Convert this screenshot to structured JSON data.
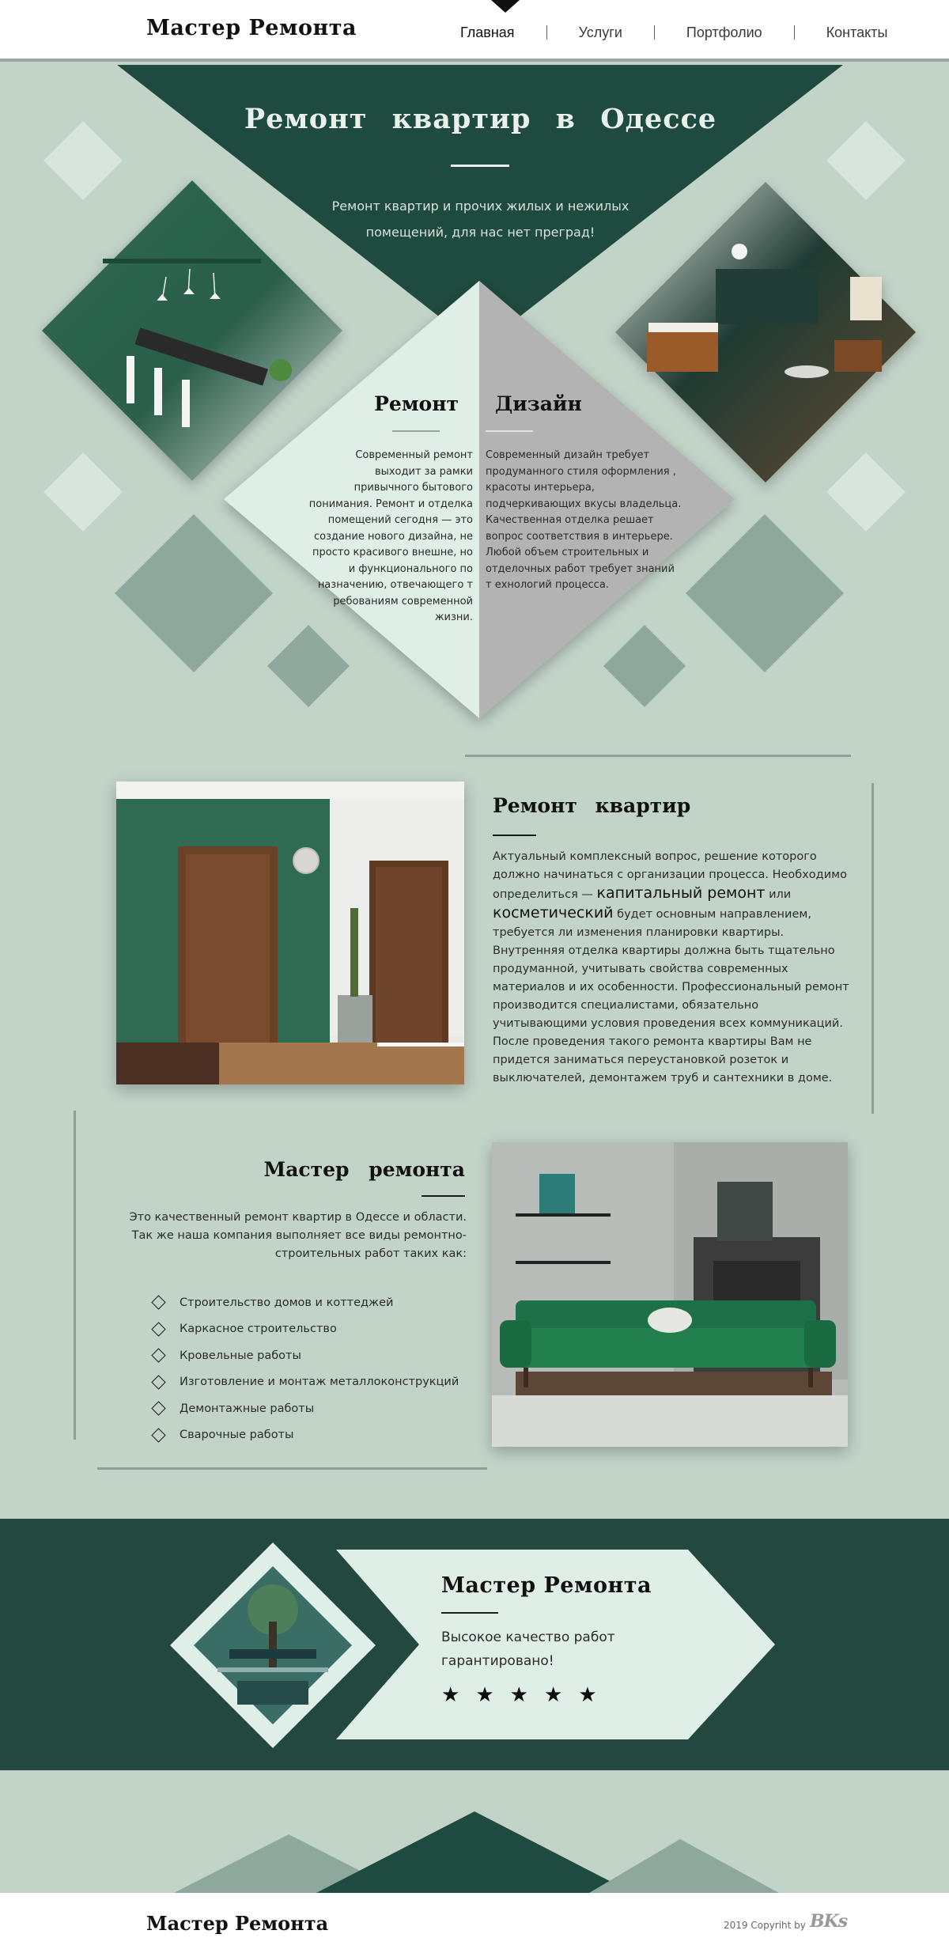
{
  "header": {
    "logo": "Мастер Ремонта",
    "nav": [
      {
        "label": "Главная",
        "active": true
      },
      {
        "label": "Услуги",
        "active": false
      },
      {
        "label": "Портфолио",
        "active": false
      },
      {
        "label": "Контакты",
        "active": false
      }
    ]
  },
  "hero": {
    "title": "Ремонт квартир в Одессе",
    "subtitle": "Ремонт квартир и прочих жилых и нежилых помещений, для нас нет преград!",
    "columns": {
      "repair": {
        "title": "Ремонт",
        "text": "Современный ремонт выходит за рамки привычного бытового понимания. Ремонт и отделка помещений сегодня — это создание нового дизайна, не просто красивого внешне, но и функционального по назначению, отвечающего т ребованиям современной жизни."
      },
      "design": {
        "title": "Дизайн",
        "text": "Современный дизайн требует продуманного стиля оформления , красоты интерьера, подчеркивающих вкусы владельца. Качественная отделка решает вопрос соответствия в интерьере. Любой объем строительных и отделочных работ требует знаний т ехнологий процесса."
      }
    }
  },
  "about": {
    "title": "Ремонт квартир",
    "text_before": "Актуальный комплексный вопрос, решение которого должно начинаться с организации процесса. Необходимо определиться — ",
    "emph1": "капитальный ремонт",
    "text_mid": " или ",
    "emph2": "косметический",
    "text_after": " будет основным направлением, требуется ли изменения планировки квартиры. Внутренняя отделка квартиры должна быть тщательно продуманной, учитывать свойства современных материалов и их особенности. Профессиональный ремонт производится специалистами, обязательно учитывающими условия проведения всех коммуникаций. После проведения такого ремонта квартиры Вам не придется заниматься переустановкой розеток и выключателей, демонтажем труб и сантехники в доме."
  },
  "master": {
    "title": "Мастер ремонта",
    "text": "Это качественный ремонт квартир в Одессе и области. Так же наша компания выполняет все виды ремонтно-строительных работ таких как:",
    "services": [
      "Строительство домов и коттеджей",
      "Каркасное строительство",
      "Кровельные работы",
      "Изготовление и монтаж металлоконструкций",
      "Демонтажные работы",
      "Сварочные работы"
    ]
  },
  "banner": {
    "title": "Мастер Ремонта",
    "text": "Высокое качество работ гарантировано!",
    "rating": 5,
    "star_glyph": "★"
  },
  "footer": {
    "logo": "Мастер Ремонта",
    "copyright": "2019 Copyriht by",
    "brand": "BKs"
  },
  "colors": {
    "dark_green": "#1f4a40",
    "sage": "#c2d3c8",
    "mint": "#dfeee6",
    "grey": "#b3b3b3"
  }
}
